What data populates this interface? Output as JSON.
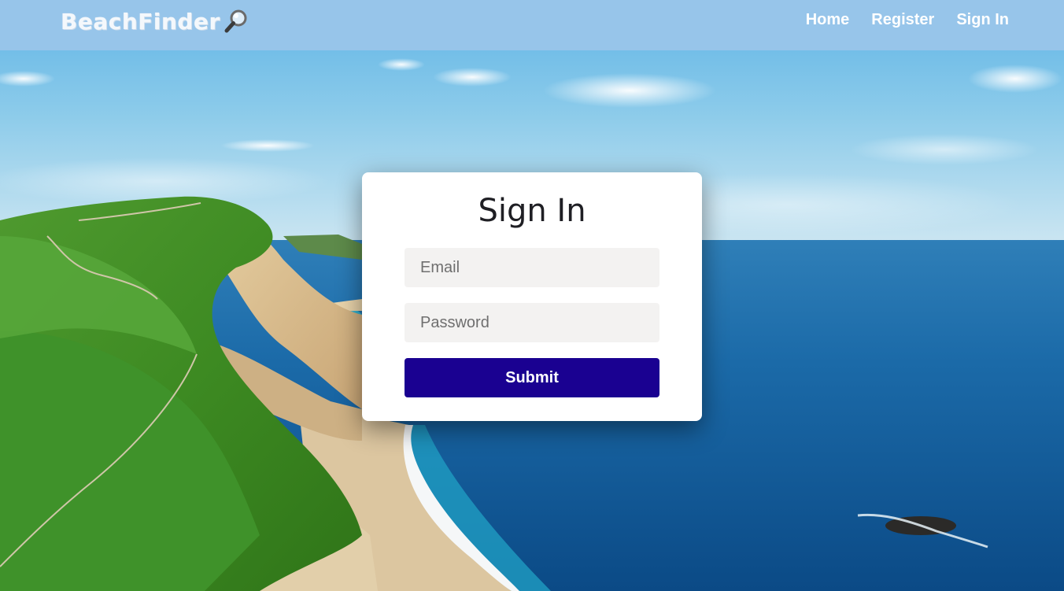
{
  "navbar": {
    "brand": "BeachFinder",
    "brand_icon": "magnifying-glass-icon",
    "links": [
      "Home",
      "Register",
      "Sign In"
    ]
  },
  "signin": {
    "title": "Sign In",
    "email_placeholder": "Email",
    "password_placeholder": "Password",
    "submit_label": "Submit"
  },
  "colors": {
    "navbar_bg": "#97c5ea",
    "submit_bg": "#1a0191",
    "input_bg": "#f3f2f1",
    "card_bg": "#ffffff"
  },
  "background": {
    "description_icon": "coastal-landscape-image"
  }
}
